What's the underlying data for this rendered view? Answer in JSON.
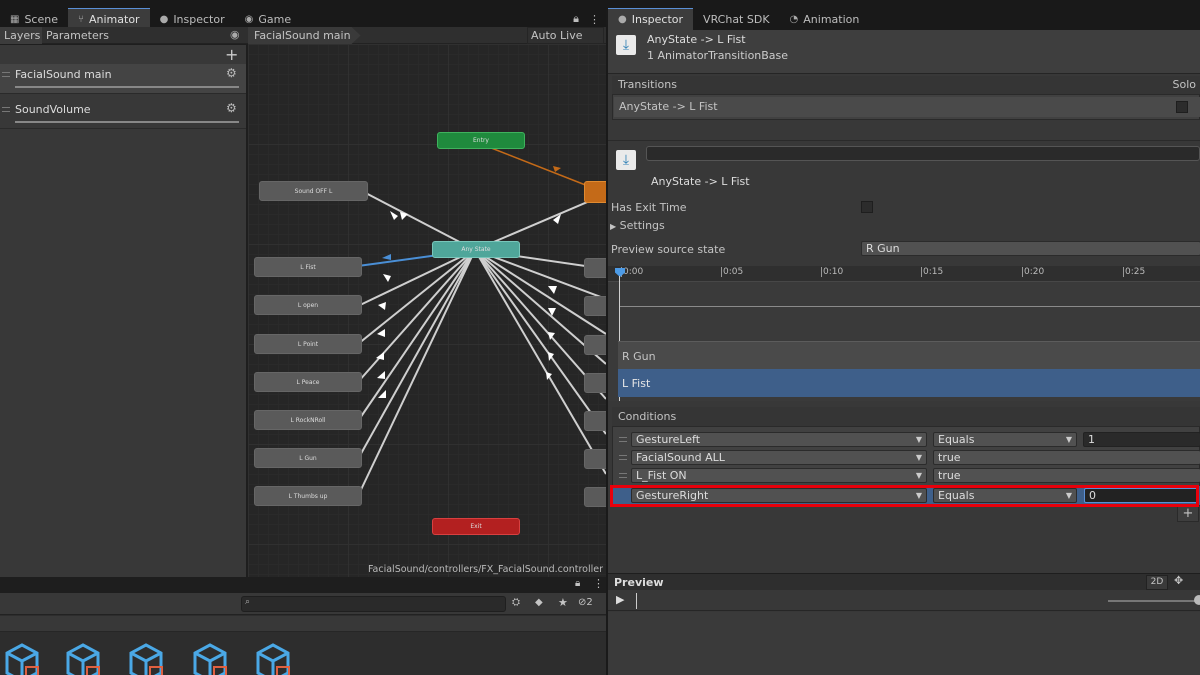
{
  "left_tabs": [
    {
      "icon": "grid-icon",
      "label": "Scene"
    },
    {
      "icon": "animator-icon",
      "label": "Animator"
    },
    {
      "icon": "info-icon",
      "label": "Inspector"
    },
    {
      "icon": "gamepad-icon",
      "label": "Game"
    }
  ],
  "right_tabs": [
    {
      "icon": "info-icon",
      "label": "Inspector"
    },
    {
      "label": "VRChat SDK"
    },
    {
      "icon": "clock-icon",
      "label": "Animation"
    }
  ],
  "animator": {
    "subtabs": [
      "Layers",
      "Parameters"
    ],
    "breadcrumb": "FacialSound main",
    "auto_live_link": "Auto Live Link",
    "add_label": "+",
    "layers": [
      {
        "name": "FacialSound main"
      },
      {
        "name": "SoundVolume"
      }
    ],
    "states": {
      "entry": "Entry",
      "any_state": "Any State",
      "exit": "Exit",
      "sound_off": "Sound OFF L",
      "left": [
        "L Fist",
        "L open",
        "L Point",
        "L Peace",
        "L RockNRoll",
        "L Gun",
        "L Thumbs up"
      ]
    },
    "path": "FacialSound/controllers/FX_FacialSound.controller"
  },
  "project": {
    "search_placeholder": "",
    "hidden_count": "2",
    "package_count": 5
  },
  "inspector": {
    "header_title": "AnyState -> L Fist",
    "header_subtitle": "1 AnimatorTransitionBase",
    "transitions_label": "Transitions",
    "solo_label": "Solo",
    "transition_item": "AnyState -> L Fist",
    "transition_name_value": "",
    "transition_caption": "AnyState -> L Fist",
    "has_exit_time": "Has Exit Time",
    "settings": "Settings",
    "preview_source_label": "Preview source state",
    "preview_source_value": "R Gun",
    "timeline_ticks": [
      "0:00",
      "0:05",
      "0:10",
      "0:15",
      "0:20",
      "0:25"
    ],
    "track_from": "R Gun",
    "track_to": "L Fist",
    "conditions_label": "Conditions",
    "conditions": [
      {
        "param": "GestureLeft",
        "mode": "Equals",
        "value": "1"
      },
      {
        "param": "FacialSound ALL",
        "mode": "true",
        "value": ""
      },
      {
        "param": "L_Fist ON",
        "mode": "true",
        "value": ""
      },
      {
        "param": "GestureRight",
        "mode": "Equals",
        "value": "0"
      }
    ],
    "add_condition": "+",
    "preview_label": "Preview",
    "preview_2d": "2D"
  },
  "colors": {
    "highlight": "#e8000b",
    "selection": "#3e5f8a",
    "entry": "#1f8a3d",
    "any_state": "#4fa69a",
    "exit": "#b32020",
    "default_state": "#c46a18"
  }
}
